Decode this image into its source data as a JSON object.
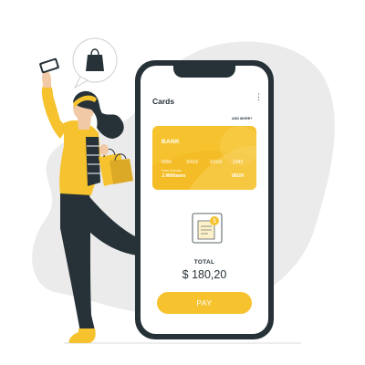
{
  "colors": {
    "accent": "#f6c32f",
    "dark": "#263238",
    "blob": "#ebebeb"
  },
  "icons": {
    "bubble": "shopping-bag-icon",
    "menu": "more-vert-icon",
    "receipt": "receipt-icon"
  },
  "app": {
    "title": "Cards",
    "add_more": "ADD MORE+"
  },
  "card": {
    "bank": "BANK",
    "number_groups": [
      "4356",
      "XXXX",
      "XXXX",
      "1342"
    ],
    "holder_label": "CARD HOLDER",
    "holder": "J.Williams",
    "expiry": "06/24"
  },
  "checkout": {
    "total_label": "TOTAL",
    "total_amount": "$ 180,20",
    "pay_label": "PAY"
  }
}
